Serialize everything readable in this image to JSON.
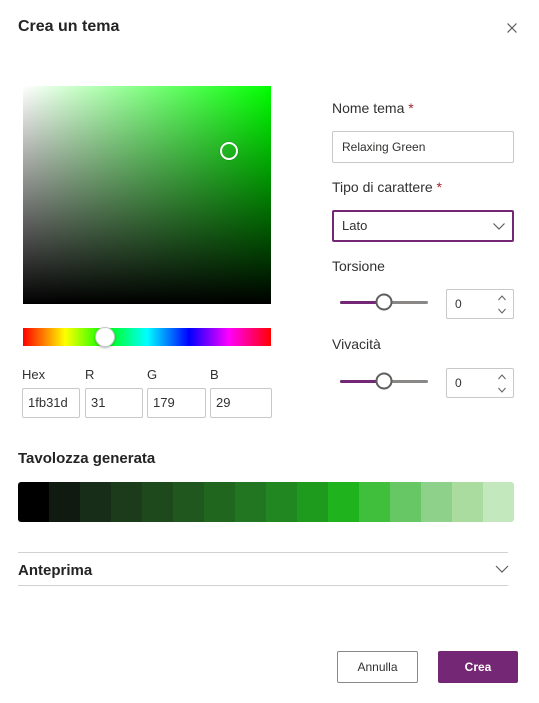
{
  "dialog": {
    "title": "Crea un tema",
    "close_label": "Chiudi"
  },
  "color_picker": {
    "hex_label": "Hex",
    "r_label": "R",
    "g_label": "G",
    "b_label": "B",
    "hex_value": "1fb31d",
    "r_value": "31",
    "g_value": "179",
    "b_value": "29",
    "base_hue_color": "#00ff00",
    "hue_level": 0.33,
    "saturation": 0.83,
    "brightness": 0.7
  },
  "form": {
    "theme_name_label": "Nome tema",
    "required_mark": "*",
    "theme_name_value": "Relaxing Green",
    "font_type_label": "Tipo di carattere",
    "font_type_value": "Lato",
    "torsion_label": "Torsione",
    "torsion_value": "0",
    "torsion_level": 0.5,
    "vividness_label": "Vivacità",
    "vividness_value": "0",
    "vividness_level": 0.5
  },
  "palette": {
    "title": "Tavolozza generata",
    "swatches": [
      "#000000",
      "#111a10",
      "#182d17",
      "#1c3b1b",
      "#1e491d",
      "#1f571e",
      "#21661f",
      "#227521",
      "#218720",
      "#1e9a1d",
      "#1fb31d",
      "#3fbf3c",
      "#68c765",
      "#8ed18b",
      "#aadc9f",
      "#c4e8bd"
    ]
  },
  "preview": {
    "title": "Anteprima"
  },
  "footer": {
    "cancel_label": "Annulla",
    "create_label": "Crea"
  },
  "colors": {
    "accent": "#742774",
    "required": "#a4262c"
  }
}
